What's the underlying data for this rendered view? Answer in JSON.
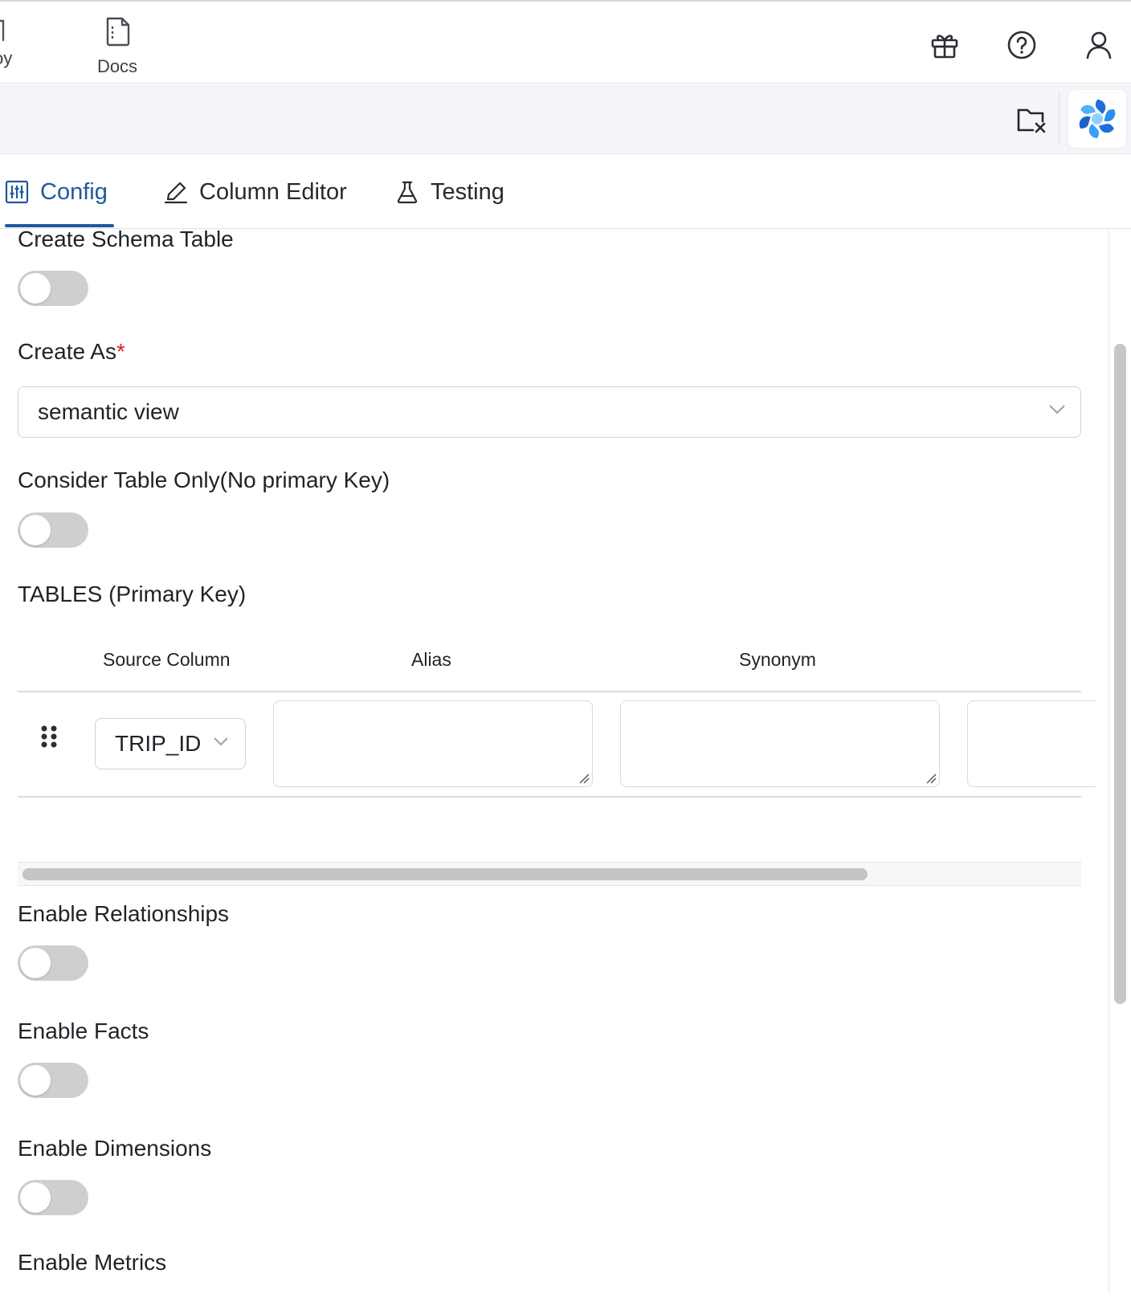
{
  "topnav": {
    "partial_item_label": "oy",
    "docs_label": "Docs",
    "icons": [
      "file-icon",
      "gift-icon",
      "help-icon",
      "user-icon"
    ]
  },
  "subbar": {
    "icons": [
      "folder-close-icon",
      "app-logo-icon"
    ]
  },
  "tabs": [
    {
      "label": "Config",
      "icon": "sliders-icon",
      "active": true
    },
    {
      "label": "Column Editor",
      "icon": "pencil-icon",
      "active": false
    },
    {
      "label": "Testing",
      "icon": "flask-icon",
      "active": false
    }
  ],
  "form": {
    "create_schema_table": {
      "label": "Create Schema Table",
      "enabled": false
    },
    "create_as": {
      "label": "Create As",
      "required_mark": "*",
      "value": "semantic view"
    },
    "consider_table_only": {
      "label": "Consider Table Only(No primary Key)",
      "enabled": false
    },
    "tables": {
      "title": "TABLES (Primary Key)",
      "columns": [
        "Source Column",
        "Alias",
        "Synonym"
      ],
      "rows": [
        {
          "source_column": "TRIP_ID",
          "alias": "",
          "synonym": ""
        }
      ]
    },
    "enable_relationships": {
      "label": "Enable Relationships",
      "enabled": false
    },
    "enable_facts": {
      "label": "Enable Facts",
      "enabled": false
    },
    "enable_dimensions": {
      "label": "Enable Dimensions",
      "enabled": false
    },
    "enable_metrics": {
      "label": "Enable Metrics",
      "enabled": false
    }
  },
  "colors": {
    "accent": "#1d5a9c",
    "toggle_off": "#cfcfcf",
    "required": "#d92020"
  }
}
